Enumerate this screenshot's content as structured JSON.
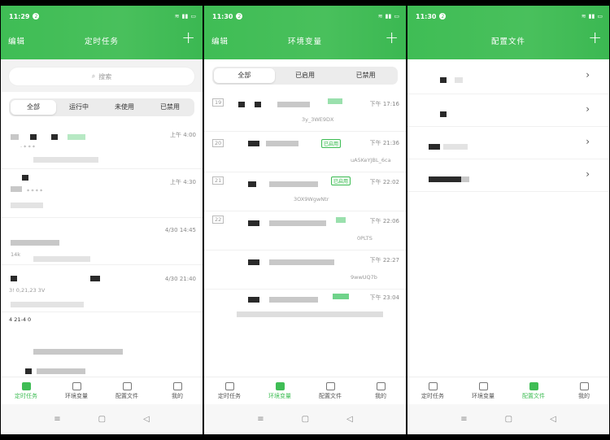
{
  "status": {
    "time1": "11:29",
    "time2": "11:30",
    "time3": "11:30",
    "notif": "2",
    "battery": "4G"
  },
  "screen1": {
    "edit_label": "编辑",
    "title": "定时任务",
    "search_placeholder": "搜索",
    "filters": [
      "全部",
      "运行中",
      "未使用",
      "已禁用"
    ],
    "rows": [
      {
        "time": "上午 4:00",
        "line2": "· * * *"
      },
      {
        "time": "上午 4:30",
        "line2": "* * * *"
      },
      {
        "time": "4/30 14:45",
        "line2": "14k"
      },
      {
        "time": "4/30 21:40",
        "line2": "3! 0,21,23 3V"
      },
      {
        "time": "",
        "line2": "4 21-4 0"
      }
    ]
  },
  "screen2": {
    "edit_label": "编辑",
    "title": "环境变量",
    "filters": [
      "全部",
      "已启用",
      "已禁用"
    ],
    "rows": [
      {
        "num": "19",
        "time": "下午 17:16",
        "sub": "3y_3WE9DX"
      },
      {
        "num": "20",
        "time": "下午 21:36",
        "sub": "uA5KeYJBL_6ca"
      },
      {
        "num": "21",
        "time": "下午 22:02",
        "sub": "3OX9WgwNtr"
      },
      {
        "num": "22",
        "time": "下午 22:06",
        "sub": "0PLTS"
      },
      {
        "num": "",
        "time": "下午 22:27",
        "sub": "9wwUQ7b"
      },
      {
        "num": "",
        "time": "下午 23:04",
        "sub": ""
      }
    ],
    "badge": "已启用"
  },
  "screen3": {
    "title": "配置文件",
    "items": [
      "",
      "",
      "",
      ""
    ]
  },
  "tabbar": [
    "定时任务",
    "环境变量",
    "配置文件",
    "我的"
  ]
}
